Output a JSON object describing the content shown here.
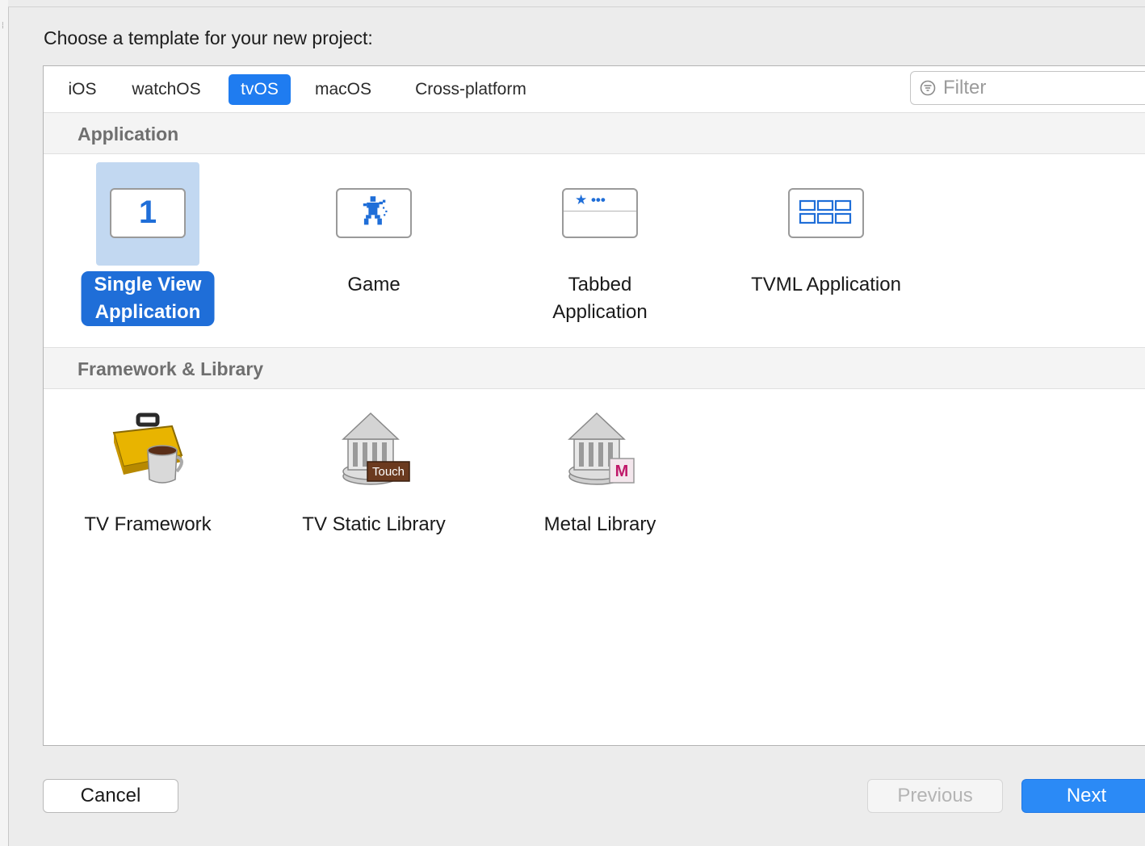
{
  "dialog": {
    "title": "Choose a template for your new project:"
  },
  "tabs": [
    {
      "label": "iOS",
      "selected": false
    },
    {
      "label": "watchOS",
      "selected": false
    },
    {
      "label": "tvOS",
      "selected": true
    },
    {
      "label": "macOS",
      "selected": false
    },
    {
      "label": "Cross-platform",
      "selected": false
    }
  ],
  "filter": {
    "placeholder": "Filter",
    "value": "",
    "icon": "filter-icon"
  },
  "sections": {
    "application": {
      "title": "Application",
      "items": [
        {
          "line1": "Single View",
          "line2": "Application",
          "icon": "single-view-icon",
          "selected": true,
          "icon_text": "1"
        },
        {
          "line1": "Game",
          "line2": "",
          "icon": "game-icon",
          "selected": false
        },
        {
          "line1": "Tabbed",
          "line2": "Application",
          "icon": "tabbed-app-icon",
          "selected": false,
          "icon_text": "★ •••"
        },
        {
          "line1": "TVML Application",
          "line2": "",
          "icon": "tvml-app-icon",
          "selected": false
        }
      ]
    },
    "framework": {
      "title": "Framework & Library",
      "items": [
        {
          "label": "TV Framework",
          "icon": "toolbox-framework-icon"
        },
        {
          "label": "TV Static Library",
          "icon": "static-library-icon",
          "badge": "Touch"
        },
        {
          "label": "Metal Library",
          "icon": "metal-library-icon",
          "badge": "M"
        }
      ]
    }
  },
  "buttons": {
    "cancel": "Cancel",
    "previous": "Previous",
    "next": "Next"
  },
  "colors": {
    "accent": "#1f7cf0",
    "selection_label": "#1f6ed8",
    "selection_highlight": "#c2d8f1",
    "next_button": "#2b8af6"
  }
}
